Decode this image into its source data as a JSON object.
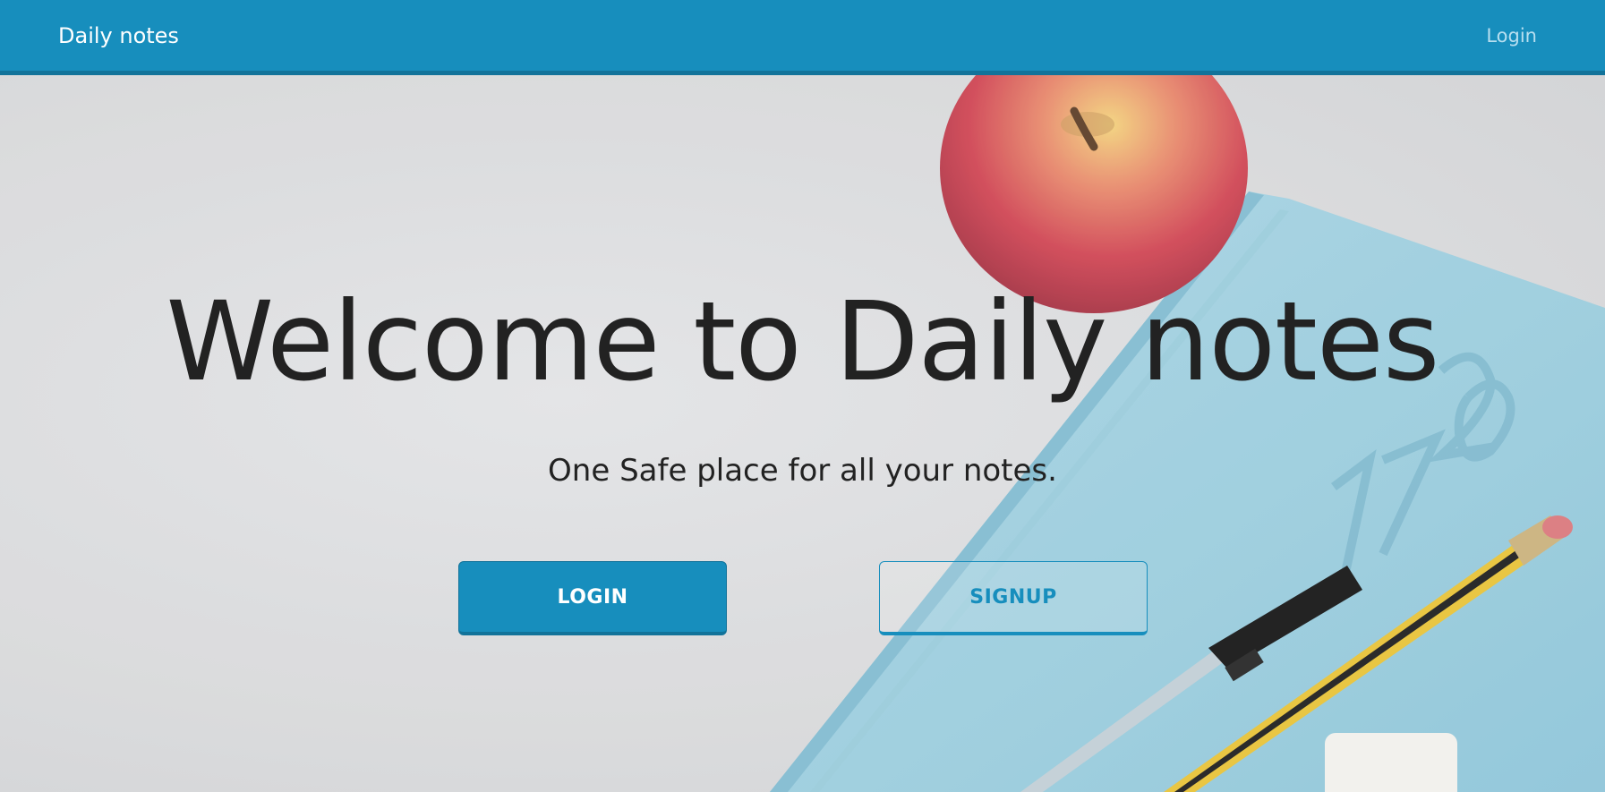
{
  "navbar": {
    "brand": "Daily notes",
    "login_link": "Login"
  },
  "hero": {
    "title": "Welcome to Daily notes",
    "subtitle": "One Safe place for all your notes.",
    "login_button": "LOGIN",
    "signup_button": "SIGNUP",
    "background_image": "desk with apple, blue 2017 notebook, pen, pencil and eraser"
  },
  "colors": {
    "brand": "#178ebd",
    "brand_dark": "#12739a",
    "text": "#222222",
    "background": "#d9dadc"
  }
}
